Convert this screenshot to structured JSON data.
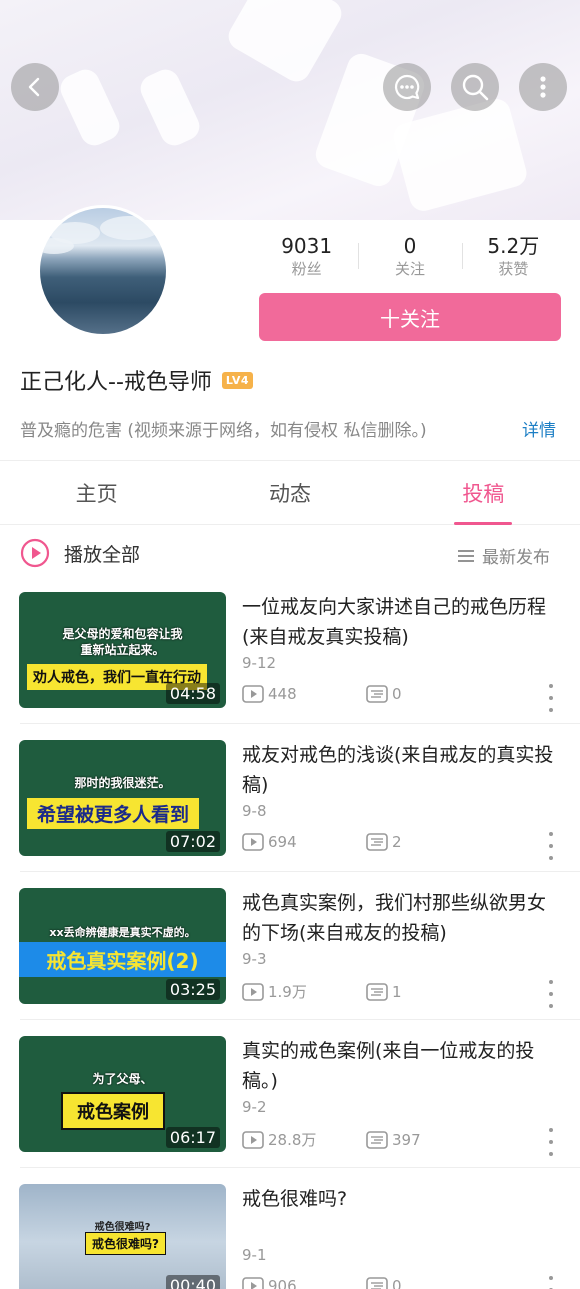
{
  "header": {
    "icons": [
      "back-icon",
      "chat-icon",
      "search-icon",
      "more-vertical-icon"
    ]
  },
  "profile": {
    "stats": [
      {
        "value": "9031",
        "label": "粉丝"
      },
      {
        "value": "0",
        "label": "关注"
      },
      {
        "value": "5.2万",
        "label": "获赞"
      }
    ],
    "follow_label": "十关注",
    "name": "正己化人--戒色导师",
    "level": "LV4",
    "bio": "普及瘾的危害 (视频来源于网络，如有侵权 私信删除。)",
    "detail_label": "详情"
  },
  "tabs": [
    {
      "label": "主页",
      "active": false
    },
    {
      "label": "动态",
      "active": false
    },
    {
      "label": "投稿",
      "active": true
    }
  ],
  "toolbar": {
    "play_all_label": "播放全部",
    "sort_label": "最新发布"
  },
  "videos": [
    {
      "title": "一位戒友向大家讲述自己的戒色历程(来自戒友真实投稿)",
      "date": "9-12",
      "views": "448",
      "comments": "0",
      "duration": "04:58",
      "thumb_caption": "是父母的爱和包容让我重新站立起来。",
      "thumb_banner": "劝人戒色，我们一直在行动"
    },
    {
      "title": "戒友对戒色的浅谈(来自戒友的真实投稿)",
      "date": "9-8",
      "views": "694",
      "comments": "2",
      "duration": "07:02",
      "thumb_caption": "那时的我很迷茫。",
      "thumb_banner": "希望被更多人看到"
    },
    {
      "title": "戒色真实案例，我们村那些纵欲男女的下场(来自戒友的投稿)",
      "date": "9-3",
      "views": "1.9万",
      "comments": "1",
      "duration": "03:25",
      "thumb_caption": "xx丢命辨健康是真实不虚的。",
      "thumb_banner": "戒色真实案例(2)"
    },
    {
      "title": "真实的戒色案例(来自一位戒友的投稿。)",
      "date": "9-2",
      "views": "28.8万",
      "comments": "397",
      "duration": "06:17",
      "thumb_caption": "为了父母、",
      "thumb_banner": "戒色案例"
    },
    {
      "title": "戒色很难吗?",
      "date": "9-1",
      "views": "906",
      "comments": "0",
      "duration": "00:40",
      "thumb_caption": "戒色很难吗?",
      "thumb_banner": "戒色很难吗?"
    }
  ],
  "colors": {
    "accent": "#f16a9a",
    "tab_active": "#f0578f",
    "link": "#1d7fc5"
  }
}
